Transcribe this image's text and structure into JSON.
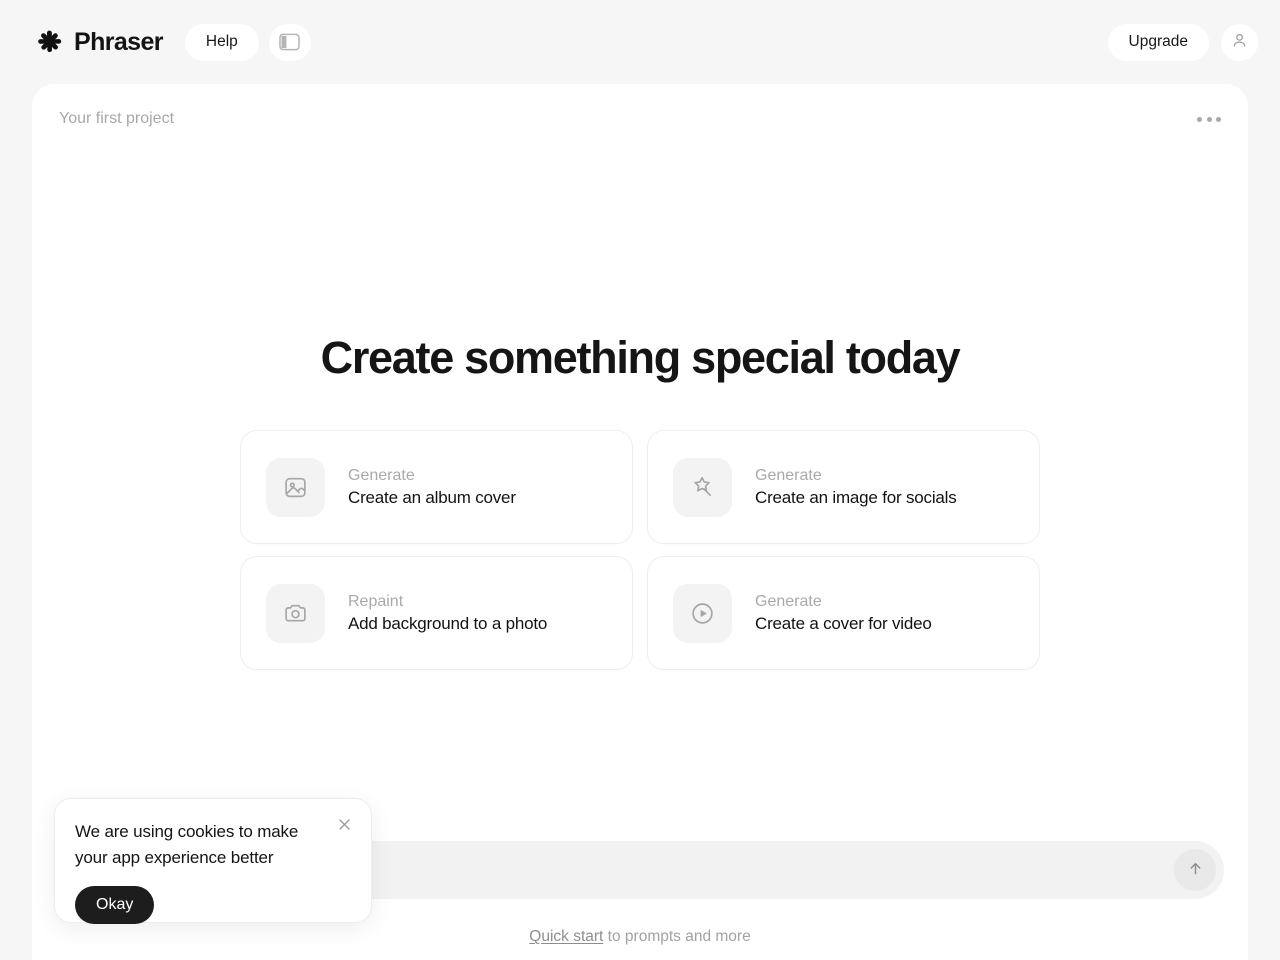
{
  "app": {
    "name": "Phraser",
    "logo_icon": "asterisk-flower-icon"
  },
  "topbar": {
    "help_label": "Help",
    "sidebar_toggle_icon": "sidebar-panel-icon",
    "upgrade_label": "Upgrade",
    "avatar_icon": "user-person-icon"
  },
  "panel": {
    "project_title": "Your first project",
    "more_icon": "ellipsis-horizontal-icon"
  },
  "hero": {
    "title": "Create something special today"
  },
  "cards": [
    {
      "label": "Generate",
      "title": "Create an album cover",
      "icon": "image-photo-icon"
    },
    {
      "label": "Generate",
      "title": "Create an image for socials",
      "icon": "magic-wand-star-icon"
    },
    {
      "label": "Repaint",
      "title": "Add background to a photo",
      "icon": "camera-icon"
    },
    {
      "label": "Generate",
      "title": "Create a cover for video",
      "icon": "play-circle-icon"
    }
  ],
  "prompt": {
    "value": "",
    "placeholder": "",
    "send_icon": "arrow-up-icon"
  },
  "footnote": {
    "link_label": "Quick start",
    "rest": " to prompts and more"
  },
  "cookie": {
    "message": "We are using cookies to make your app experience better",
    "okay_label": "Okay",
    "close_icon": "close-x-icon"
  },
  "colors": {
    "page_background": "#f6f6f6",
    "panel_background": "#ffffff",
    "accent_dark": "#1d1d1d",
    "muted_text": "#a9a9a9",
    "primary_text": "#141414",
    "icon_tile": "#f3f3f3"
  }
}
